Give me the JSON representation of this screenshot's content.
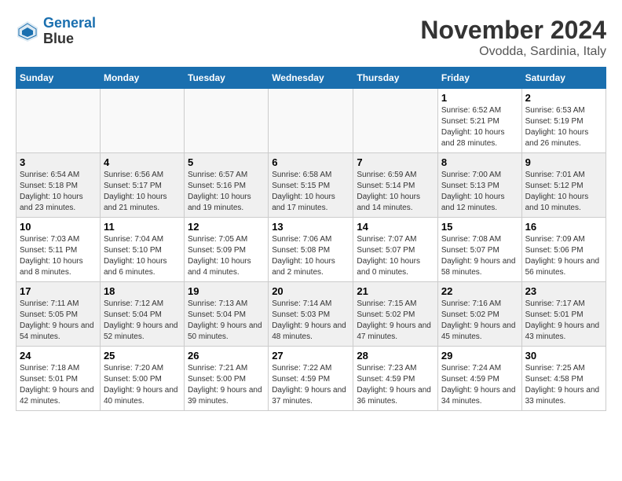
{
  "header": {
    "logo_line1": "General",
    "logo_line2": "Blue",
    "month": "November 2024",
    "location": "Ovodda, Sardinia, Italy"
  },
  "weekdays": [
    "Sunday",
    "Monday",
    "Tuesday",
    "Wednesday",
    "Thursday",
    "Friday",
    "Saturday"
  ],
  "weeks": [
    [
      {
        "day": "",
        "info": ""
      },
      {
        "day": "",
        "info": ""
      },
      {
        "day": "",
        "info": ""
      },
      {
        "day": "",
        "info": ""
      },
      {
        "day": "",
        "info": ""
      },
      {
        "day": "1",
        "info": "Sunrise: 6:52 AM\nSunset: 5:21 PM\nDaylight: 10 hours and 28 minutes."
      },
      {
        "day": "2",
        "info": "Sunrise: 6:53 AM\nSunset: 5:19 PM\nDaylight: 10 hours and 26 minutes."
      }
    ],
    [
      {
        "day": "3",
        "info": "Sunrise: 6:54 AM\nSunset: 5:18 PM\nDaylight: 10 hours and 23 minutes."
      },
      {
        "day": "4",
        "info": "Sunrise: 6:56 AM\nSunset: 5:17 PM\nDaylight: 10 hours and 21 minutes."
      },
      {
        "day": "5",
        "info": "Sunrise: 6:57 AM\nSunset: 5:16 PM\nDaylight: 10 hours and 19 minutes."
      },
      {
        "day": "6",
        "info": "Sunrise: 6:58 AM\nSunset: 5:15 PM\nDaylight: 10 hours and 17 minutes."
      },
      {
        "day": "7",
        "info": "Sunrise: 6:59 AM\nSunset: 5:14 PM\nDaylight: 10 hours and 14 minutes."
      },
      {
        "day": "8",
        "info": "Sunrise: 7:00 AM\nSunset: 5:13 PM\nDaylight: 10 hours and 12 minutes."
      },
      {
        "day": "9",
        "info": "Sunrise: 7:01 AM\nSunset: 5:12 PM\nDaylight: 10 hours and 10 minutes."
      }
    ],
    [
      {
        "day": "10",
        "info": "Sunrise: 7:03 AM\nSunset: 5:11 PM\nDaylight: 10 hours and 8 minutes."
      },
      {
        "day": "11",
        "info": "Sunrise: 7:04 AM\nSunset: 5:10 PM\nDaylight: 10 hours and 6 minutes."
      },
      {
        "day": "12",
        "info": "Sunrise: 7:05 AM\nSunset: 5:09 PM\nDaylight: 10 hours and 4 minutes."
      },
      {
        "day": "13",
        "info": "Sunrise: 7:06 AM\nSunset: 5:08 PM\nDaylight: 10 hours and 2 minutes."
      },
      {
        "day": "14",
        "info": "Sunrise: 7:07 AM\nSunset: 5:07 PM\nDaylight: 10 hours and 0 minutes."
      },
      {
        "day": "15",
        "info": "Sunrise: 7:08 AM\nSunset: 5:07 PM\nDaylight: 9 hours and 58 minutes."
      },
      {
        "day": "16",
        "info": "Sunrise: 7:09 AM\nSunset: 5:06 PM\nDaylight: 9 hours and 56 minutes."
      }
    ],
    [
      {
        "day": "17",
        "info": "Sunrise: 7:11 AM\nSunset: 5:05 PM\nDaylight: 9 hours and 54 minutes."
      },
      {
        "day": "18",
        "info": "Sunrise: 7:12 AM\nSunset: 5:04 PM\nDaylight: 9 hours and 52 minutes."
      },
      {
        "day": "19",
        "info": "Sunrise: 7:13 AM\nSunset: 5:04 PM\nDaylight: 9 hours and 50 minutes."
      },
      {
        "day": "20",
        "info": "Sunrise: 7:14 AM\nSunset: 5:03 PM\nDaylight: 9 hours and 48 minutes."
      },
      {
        "day": "21",
        "info": "Sunrise: 7:15 AM\nSunset: 5:02 PM\nDaylight: 9 hours and 47 minutes."
      },
      {
        "day": "22",
        "info": "Sunrise: 7:16 AM\nSunset: 5:02 PM\nDaylight: 9 hours and 45 minutes."
      },
      {
        "day": "23",
        "info": "Sunrise: 7:17 AM\nSunset: 5:01 PM\nDaylight: 9 hours and 43 minutes."
      }
    ],
    [
      {
        "day": "24",
        "info": "Sunrise: 7:18 AM\nSunset: 5:01 PM\nDaylight: 9 hours and 42 minutes."
      },
      {
        "day": "25",
        "info": "Sunrise: 7:20 AM\nSunset: 5:00 PM\nDaylight: 9 hours and 40 minutes."
      },
      {
        "day": "26",
        "info": "Sunrise: 7:21 AM\nSunset: 5:00 PM\nDaylight: 9 hours and 39 minutes."
      },
      {
        "day": "27",
        "info": "Sunrise: 7:22 AM\nSunset: 4:59 PM\nDaylight: 9 hours and 37 minutes."
      },
      {
        "day": "28",
        "info": "Sunrise: 7:23 AM\nSunset: 4:59 PM\nDaylight: 9 hours and 36 minutes."
      },
      {
        "day": "29",
        "info": "Sunrise: 7:24 AM\nSunset: 4:59 PM\nDaylight: 9 hours and 34 minutes."
      },
      {
        "day": "30",
        "info": "Sunrise: 7:25 AM\nSunset: 4:58 PM\nDaylight: 9 hours and 33 minutes."
      }
    ]
  ]
}
